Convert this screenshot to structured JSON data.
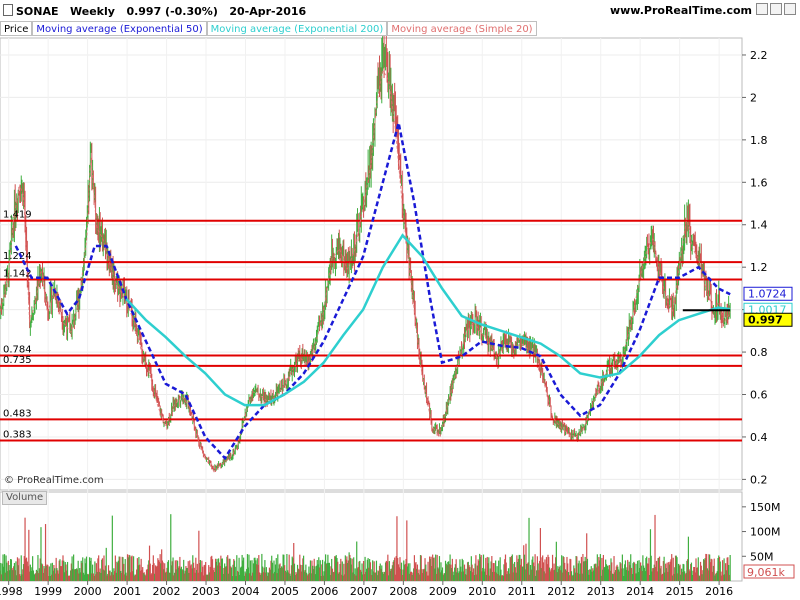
{
  "header": {
    "symbol": "SONAE",
    "period": "Weekly",
    "last": "0.997 (-0.30%)",
    "date": "20-Apr-2016",
    "site": "www.ProRealTime.com"
  },
  "legend": [
    {
      "label": "Price",
      "color": "#000000"
    },
    {
      "label": "Moving average (Exponential 50)",
      "color": "#1a1ad6"
    },
    {
      "label": "Moving average (Exponential 200)",
      "color": "#2ecfcf"
    },
    {
      "label": "Moving average (Simple 20)",
      "color": "#e07070"
    }
  ],
  "copyright": "© ProRealTime.com",
  "volume_label": "Volume",
  "colors": {
    "up": "#3fae3f",
    "down": "#d05050",
    "level": "#e00000",
    "ema50": "#1a1ad6",
    "ema200": "#2ecfcf",
    "sma20": "#e07070"
  },
  "chart_data": {
    "type": "line",
    "title": "SONAE Weekly",
    "x_ticks": [
      "1998",
      "1999",
      "2000",
      "2001",
      "2002",
      "2003",
      "2004",
      "2005",
      "2006",
      "2007",
      "2008",
      "2009",
      "2010",
      "2011",
      "2012",
      "2013",
      "2014",
      "2015",
      "2016"
    ],
    "xlim": [
      1997.8,
      2016.6
    ],
    "ylim": [
      0.15,
      2.28
    ],
    "y_ticks": [
      "0.2",
      "0.4",
      "0.6",
      "0.8",
      "1",
      "1.2",
      "1.4",
      "1.6",
      "1.8",
      "2",
      "2.2"
    ],
    "price": [
      [
        1997.8,
        1.0
      ],
      [
        1998.0,
        1.15
      ],
      [
        1998.15,
        1.45
      ],
      [
        1998.3,
        1.6
      ],
      [
        1998.4,
        1.55
      ],
      [
        1998.55,
        0.95
      ],
      [
        1998.7,
        1.05
      ],
      [
        1998.85,
        1.2
      ],
      [
        1999.0,
        1.0
      ],
      [
        1999.2,
        1.1
      ],
      [
        1999.4,
        0.95
      ],
      [
        1999.6,
        0.9
      ],
      [
        1999.8,
        1.05
      ],
      [
        2000.0,
        1.35
      ],
      [
        2000.1,
        1.75
      ],
      [
        2000.25,
        1.4
      ],
      [
        2000.4,
        1.35
      ],
      [
        2000.55,
        1.25
      ],
      [
        2000.7,
        1.15
      ],
      [
        2000.85,
        1.1
      ],
      [
        2001.0,
        1.05
      ],
      [
        2001.2,
        0.95
      ],
      [
        2001.4,
        0.8
      ],
      [
        2001.6,
        0.7
      ],
      [
        2001.8,
        0.55
      ],
      [
        2002.0,
        0.45
      ],
      [
        2002.2,
        0.55
      ],
      [
        2002.4,
        0.6
      ],
      [
        2002.6,
        0.55
      ],
      [
        2002.8,
        0.4
      ],
      [
        2003.0,
        0.3
      ],
      [
        2003.2,
        0.25
      ],
      [
        2003.4,
        0.27
      ],
      [
        2003.6,
        0.3
      ],
      [
        2003.8,
        0.35
      ],
      [
        2004.0,
        0.5
      ],
      [
        2004.2,
        0.62
      ],
      [
        2004.4,
        0.6
      ],
      [
        2004.6,
        0.57
      ],
      [
        2004.8,
        0.6
      ],
      [
        2005.0,
        0.65
      ],
      [
        2005.2,
        0.72
      ],
      [
        2005.4,
        0.78
      ],
      [
        2005.6,
        0.75
      ],
      [
        2005.8,
        0.85
      ],
      [
        2006.0,
        1.0
      ],
      [
        2006.2,
        1.25
      ],
      [
        2006.4,
        1.3
      ],
      [
        2006.6,
        1.2
      ],
      [
        2006.8,
        1.3
      ],
      [
        2007.0,
        1.5
      ],
      [
        2007.2,
        1.7
      ],
      [
        2007.35,
        2.0
      ],
      [
        2007.5,
        2.15
      ],
      [
        2007.65,
        2.1
      ],
      [
        2007.8,
        1.9
      ],
      [
        2008.0,
        1.5
      ],
      [
        2008.15,
        1.25
      ],
      [
        2008.3,
        1.0
      ],
      [
        2008.45,
        0.75
      ],
      [
        2008.6,
        0.6
      ],
      [
        2008.75,
        0.45
      ],
      [
        2008.9,
        0.42
      ],
      [
        2009.0,
        0.45
      ],
      [
        2009.2,
        0.6
      ],
      [
        2009.4,
        0.75
      ],
      [
        2009.6,
        0.9
      ],
      [
        2009.8,
        0.95
      ],
      [
        2010.0,
        0.9
      ],
      [
        2010.2,
        0.85
      ],
      [
        2010.4,
        0.78
      ],
      [
        2010.6,
        0.85
      ],
      [
        2010.8,
        0.82
      ],
      [
        2011.0,
        0.85
      ],
      [
        2011.2,
        0.82
      ],
      [
        2011.4,
        0.8
      ],
      [
        2011.6,
        0.65
      ],
      [
        2011.8,
        0.5
      ],
      [
        2012.0,
        0.45
      ],
      [
        2012.2,
        0.42
      ],
      [
        2012.4,
        0.4
      ],
      [
        2012.6,
        0.45
      ],
      [
        2012.8,
        0.55
      ],
      [
        2013.0,
        0.65
      ],
      [
        2013.2,
        0.72
      ],
      [
        2013.4,
        0.75
      ],
      [
        2013.6,
        0.8
      ],
      [
        2013.8,
        0.95
      ],
      [
        2014.0,
        1.15
      ],
      [
        2014.2,
        1.3
      ],
      [
        2014.35,
        1.35
      ],
      [
        2014.5,
        1.2
      ],
      [
        2014.7,
        1.05
      ],
      [
        2014.85,
        1.0
      ],
      [
        2015.0,
        1.2
      ],
      [
        2015.2,
        1.45
      ],
      [
        2015.35,
        1.3
      ],
      [
        2015.5,
        1.25
      ],
      [
        2015.7,
        1.1
      ],
      [
        2015.9,
        1.0
      ],
      [
        2016.0,
        1.05
      ],
      [
        2016.15,
        0.95
      ],
      [
        2016.3,
        0.997
      ]
    ],
    "series": [
      {
        "name": "Moving average (Exponential 50)",
        "values": [
          [
            1998.2,
            1.3
          ],
          [
            1998.6,
            1.15
          ],
          [
            1999.0,
            1.15
          ],
          [
            1999.5,
            0.98
          ],
          [
            1999.8,
            1.05
          ],
          [
            2000.2,
            1.3
          ],
          [
            2000.5,
            1.3
          ],
          [
            2001.0,
            1.05
          ],
          [
            2001.5,
            0.85
          ],
          [
            2002.0,
            0.65
          ],
          [
            2002.5,
            0.6
          ],
          [
            2003.0,
            0.4
          ],
          [
            2003.5,
            0.3
          ],
          [
            2004.0,
            0.45
          ],
          [
            2004.5,
            0.55
          ],
          [
            2005.0,
            0.6
          ],
          [
            2005.5,
            0.7
          ],
          [
            2006.0,
            0.85
          ],
          [
            2006.5,
            1.05
          ],
          [
            2007.0,
            1.25
          ],
          [
            2007.5,
            1.6
          ],
          [
            2007.9,
            1.88
          ],
          [
            2008.3,
            1.5
          ],
          [
            2008.7,
            1.05
          ],
          [
            2009.0,
            0.75
          ],
          [
            2009.5,
            0.78
          ],
          [
            2010.0,
            0.85
          ],
          [
            2010.5,
            0.83
          ],
          [
            2011.0,
            0.82
          ],
          [
            2011.5,
            0.78
          ],
          [
            2012.0,
            0.6
          ],
          [
            2012.5,
            0.5
          ],
          [
            2013.0,
            0.55
          ],
          [
            2013.5,
            0.7
          ],
          [
            2014.0,
            0.9
          ],
          [
            2014.5,
            1.15
          ],
          [
            2015.0,
            1.15
          ],
          [
            2015.5,
            1.2
          ],
          [
            2016.0,
            1.1
          ],
          [
            2016.3,
            1.0724
          ]
        ]
      },
      {
        "name": "Moving average (Exponential 200)",
        "values": [
          [
            2001.0,
            1.05
          ],
          [
            2001.5,
            0.95
          ],
          [
            2002.0,
            0.87
          ],
          [
            2002.5,
            0.78
          ],
          [
            2003.0,
            0.7
          ],
          [
            2003.5,
            0.6
          ],
          [
            2004.0,
            0.55
          ],
          [
            2004.5,
            0.55
          ],
          [
            2005.0,
            0.6
          ],
          [
            2005.5,
            0.66
          ],
          [
            2006.0,
            0.75
          ],
          [
            2006.5,
            0.88
          ],
          [
            2007.0,
            1.0
          ],
          [
            2007.5,
            1.2
          ],
          [
            2008.0,
            1.35
          ],
          [
            2008.5,
            1.25
          ],
          [
            2009.0,
            1.1
          ],
          [
            2009.5,
            0.97
          ],
          [
            2010.0,
            0.93
          ],
          [
            2010.5,
            0.9
          ],
          [
            2011.0,
            0.87
          ],
          [
            2011.5,
            0.84
          ],
          [
            2012.0,
            0.78
          ],
          [
            2012.5,
            0.7
          ],
          [
            2013.0,
            0.68
          ],
          [
            2013.5,
            0.7
          ],
          [
            2014.0,
            0.78
          ],
          [
            2014.5,
            0.88
          ],
          [
            2015.0,
            0.95
          ],
          [
            2015.5,
            0.98
          ],
          [
            2016.0,
            1.01
          ],
          [
            2016.3,
            1.0017
          ]
        ]
      }
    ],
    "levels": [
      {
        "value": 1.419,
        "label": "1.419"
      },
      {
        "value": 1.224,
        "label": "1.224"
      },
      {
        "value": 1.142,
        "label": "1.142"
      },
      {
        "value": 0.784,
        "label": "0.784"
      },
      {
        "value": 0.735,
        "label": "0.735"
      },
      {
        "value": 0.483,
        "label": "0.483"
      },
      {
        "value": 0.383,
        "label": "0.383"
      }
    ],
    "markers": [
      {
        "label": "1.0724",
        "value": 1.0724
      },
      {
        "label": "1.0017",
        "value": 1.0017
      },
      {
        "label": "0.997",
        "value": 0.997
      }
    ],
    "volume": {
      "y_ticks": [
        "50M",
        "100M",
        "150M"
      ],
      "ylim": [
        0,
        180
      ],
      "last_label": "9,061k"
    }
  }
}
